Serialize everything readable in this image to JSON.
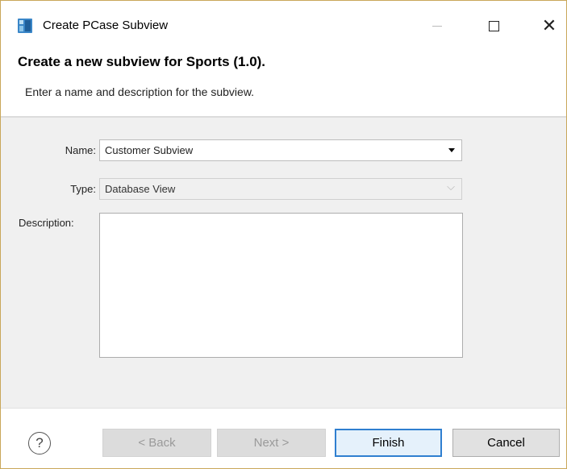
{
  "window": {
    "title": "Create PCase Subview",
    "app_icon": "pcase-app-icon",
    "minimize_icon": "minimize-icon",
    "maximize_icon": "maximize-icon",
    "close_glyph": "✕"
  },
  "header": {
    "title": "Create a new subview for Sports (1.0).",
    "description": "Enter a name and description for the subview."
  },
  "form": {
    "name_label": "Name:",
    "name_value": "Customer Subview",
    "type_label": "Type:",
    "type_value": "Database View",
    "type_chevron": "⌵",
    "description_label": "Description:",
    "description_value": ""
  },
  "footer": {
    "help_glyph": "?",
    "back_label": "< Back",
    "next_label": "Next >",
    "finish_label": "Finish",
    "cancel_label": "Cancel"
  }
}
